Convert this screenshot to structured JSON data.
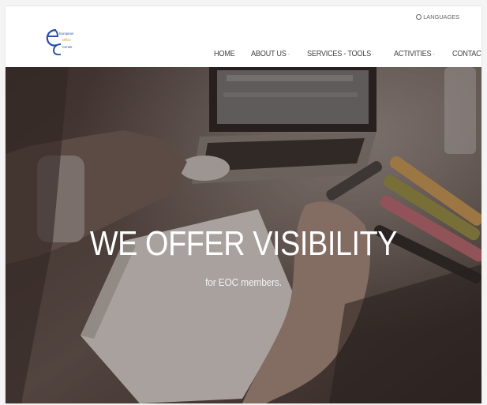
{
  "header": {
    "logo_lines": [
      "European",
      "Office",
      "Center"
    ],
    "languages_label": "LANGUAGES",
    "nav": [
      {
        "label": "HOME",
        "has_dropdown": false
      },
      {
        "label": "ABOUT US",
        "has_dropdown": true
      },
      {
        "label": "SERVICES - TOOLS",
        "has_dropdown": true
      },
      {
        "label": "ACTIVITIES",
        "has_dropdown": true
      },
      {
        "label": "CONTACT US",
        "has_dropdown": false
      }
    ],
    "dropdown_glyph": "-"
  },
  "hero": {
    "title": "WE OFFER VISIBILITY",
    "subtitle": "for EOC members."
  },
  "colors": {
    "logo_blue": "#2a4fa8",
    "nav_text": "#444444",
    "hero_text": "#ffffff"
  }
}
